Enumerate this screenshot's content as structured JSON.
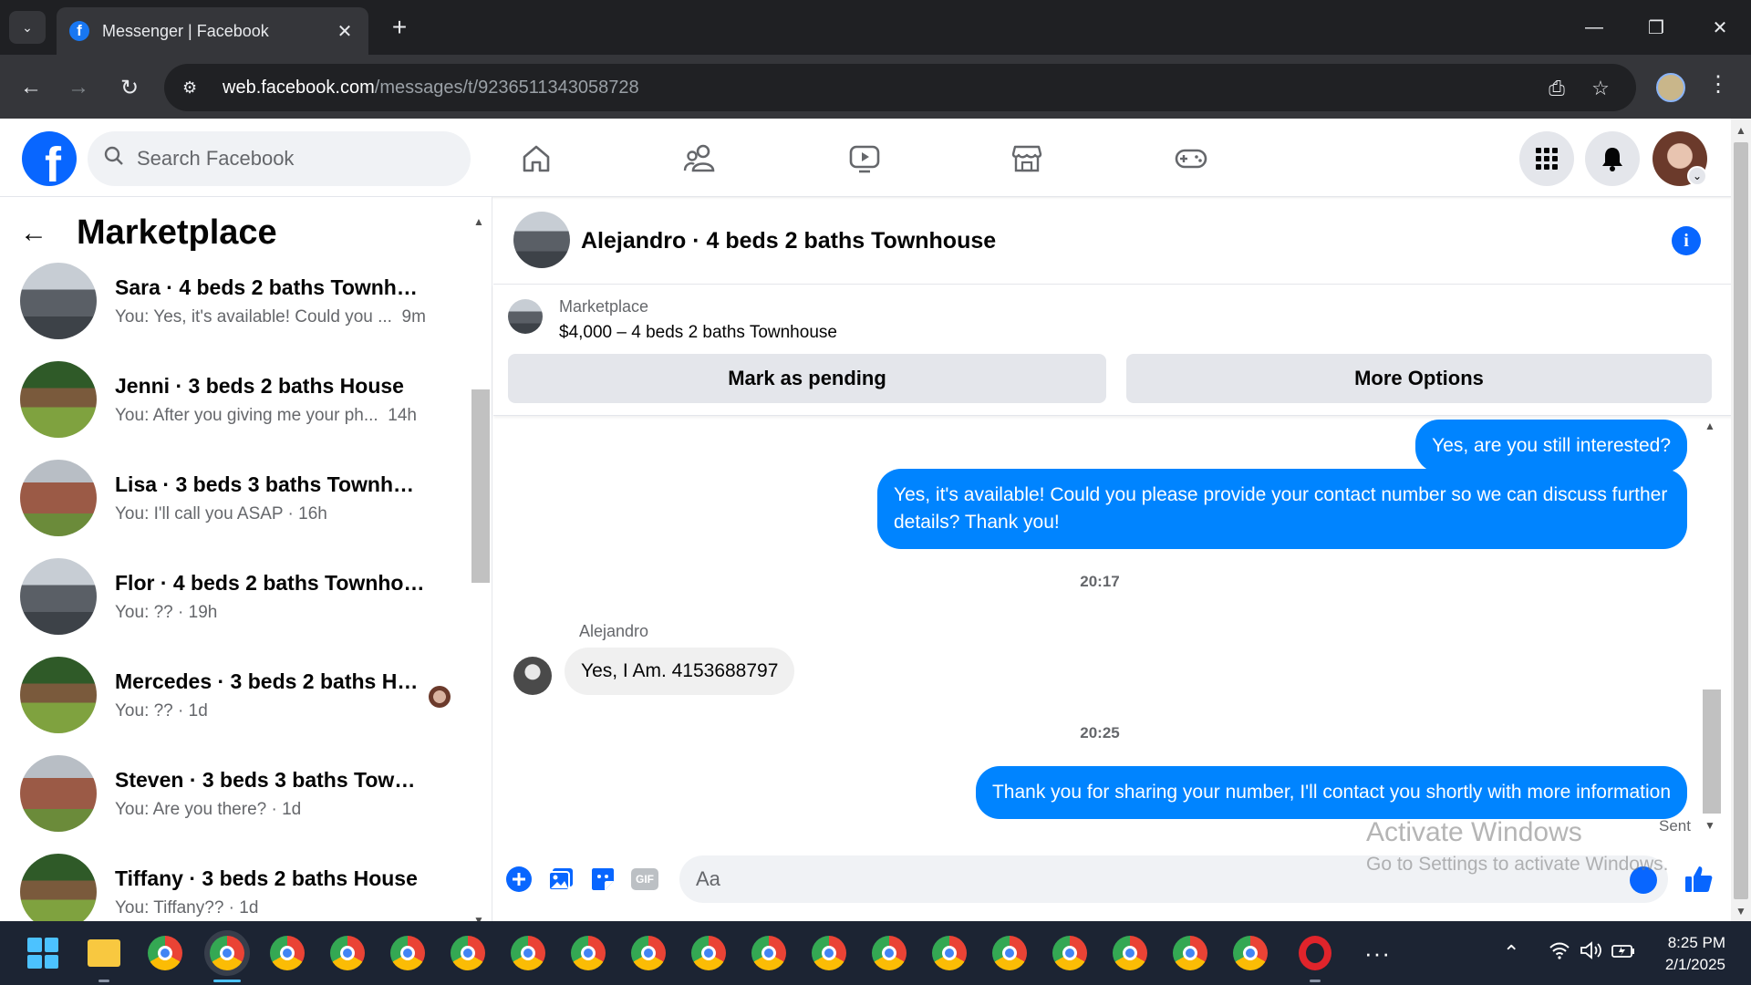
{
  "browser": {
    "tab_title": "Messenger | Facebook",
    "tab_close": "✕",
    "new_tab": "+",
    "url_host": "web.facebook.com",
    "url_path": "/messages/t/9236511343058728"
  },
  "header": {
    "logo": "f",
    "search_placeholder": "Search Facebook"
  },
  "sidebar": {
    "title": "Marketplace",
    "conversations": [
      {
        "name": "Sara · 4 beds 2 baths Townhouse",
        "preview": "You: Yes, it's available! Could you ...",
        "time": "9m",
        "thumb": "townhouse"
      },
      {
        "name": "Jenni · 3 beds 2 baths House",
        "preview": "You: After you giving me your ph...",
        "time": "14h",
        "thumb": "house"
      },
      {
        "name": "Lisa · 3 beds 3 baths Townhouse",
        "preview": "You: I'll call you ASAP · 16h",
        "time": "",
        "thumb": "brick"
      },
      {
        "name": "Flor · 4 beds 2 baths Townhouse",
        "preview": "You: ?? · 19h",
        "time": "",
        "thumb": "townhouse"
      },
      {
        "name": "Mercedes · 3 beds 2 baths Ho...",
        "preview": "You: ?? · 1d",
        "time": "",
        "thumb": "house"
      },
      {
        "name": "Steven · 3 beds 3 baths Townho...",
        "preview": "You: Are you there? · 1d",
        "time": "",
        "thumb": "brick"
      },
      {
        "name": "Tiffany · 3 beds 2 baths House",
        "preview": "You: Tiffany?? · 1d",
        "time": "",
        "thumb": "house"
      }
    ]
  },
  "chat": {
    "title": "Alejandro · 4 beds 2 baths Townhouse",
    "listing_label": "Marketplace",
    "listing_price": "$4,000 – 4 beds 2 baths Townhouse",
    "mark_pending": "Mark as pending",
    "more_options": "More Options",
    "messages": {
      "out1": "Yes, are you still interested?",
      "out2": "Yes, it's available! Could you please provide your contact number so we can discuss further details? Thank you!",
      "ts1": "20:17",
      "sender": "Alejandro",
      "in1": "Yes, I Am. 4153688797",
      "ts2": "20:25",
      "out3": "Thank you for sharing your number, I'll contact you shortly with more information",
      "sent": "Sent"
    },
    "composer_placeholder": "Aa",
    "gif_label": "GIF"
  },
  "watermark": {
    "line1": "Activate Windows",
    "line2": "Go to Settings to activate Windows."
  },
  "taskbar": {
    "time": "8:25 PM",
    "date": "2/1/2025",
    "dots": "···"
  },
  "colors": {
    "fb_blue": "#0866ff",
    "messenger_blue": "#0084ff"
  }
}
